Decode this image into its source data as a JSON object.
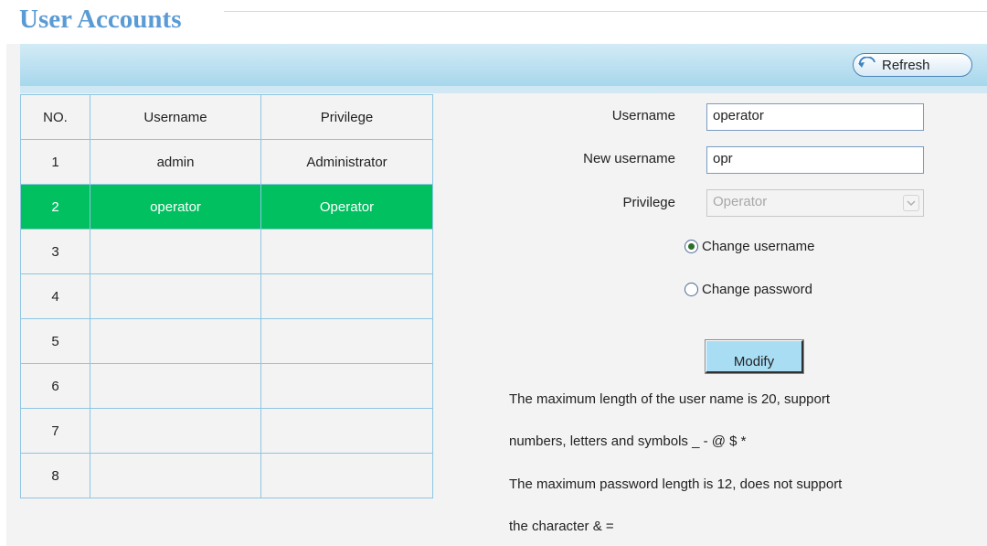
{
  "page": {
    "title": "User Accounts"
  },
  "toolbar": {
    "refresh_label": "Refresh"
  },
  "table": {
    "headers": [
      "NO.",
      "Username",
      "Privilege"
    ],
    "rows": [
      {
        "no": "1",
        "username": "admin",
        "privilege": "Administrator"
      },
      {
        "no": "2",
        "username": "operator",
        "privilege": "Operator"
      },
      {
        "no": "3",
        "username": "",
        "privilege": ""
      },
      {
        "no": "4",
        "username": "",
        "privilege": ""
      },
      {
        "no": "5",
        "username": "",
        "privilege": ""
      },
      {
        "no": "6",
        "username": "",
        "privilege": ""
      },
      {
        "no": "7",
        "username": "",
        "privilege": ""
      },
      {
        "no": "8",
        "username": "",
        "privilege": ""
      }
    ],
    "selected_row": "2"
  },
  "form": {
    "username_label": "Username",
    "username_value": "operator",
    "new_username_label": "New username",
    "new_username_value": "opr",
    "privilege_label": "Privilege",
    "privilege_value": "Operator",
    "radio_change_username": "Change username",
    "radio_change_password": "Change password",
    "selected_option": "Change username",
    "modify_label": "Modify"
  },
  "notes": [
    "The maximum length of the user name is 20, support",
    "numbers, letters and symbols _ - @ $ *",
    "The maximum password length is 12, does not support",
    "the character & ="
  ],
  "colors": {
    "title": "#5b9bd5",
    "selected_row": "#00c060",
    "table_border": "#8ec6e2",
    "toolbar": "#a7d7ec",
    "modify_button": "#a9ddf4"
  },
  "icons": {
    "refresh": "refresh-arrow-icon",
    "dropdown": "chevron-down-icon",
    "radio": "radio-icon"
  }
}
